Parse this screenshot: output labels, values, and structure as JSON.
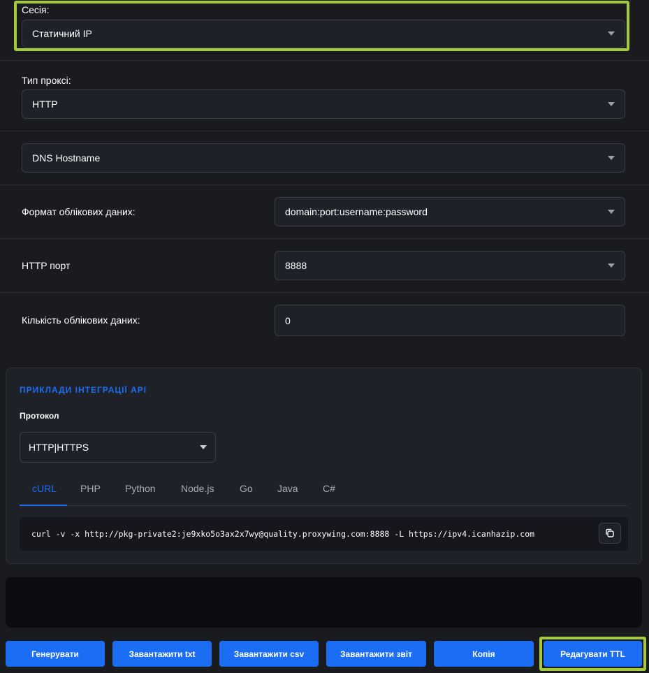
{
  "session": {
    "label": "Сесія:",
    "value": "Статичний IP"
  },
  "proxy_type": {
    "label": "Тип проксі:",
    "value": "HTTP"
  },
  "dns": {
    "value": "DNS Hostname"
  },
  "credentials_format": {
    "label": "Формат облікових даних:",
    "value": "domain:port:username:password"
  },
  "http_port": {
    "label": "HTTP порт",
    "value": "8888"
  },
  "credentials_count": {
    "label": "Кількість облікових даних:",
    "value": "0"
  },
  "api": {
    "title": "ПРИКЛАДИ ІНТЕГРАЦІЇ API",
    "protocol_label": "Протокол",
    "protocol_value": "HTTP|HTTPS",
    "tabs": [
      "cURL",
      "PHP",
      "Python",
      "Node.js",
      "Go",
      "Java",
      "C#"
    ],
    "active_tab": "cURL",
    "code": "curl -v -x http://pkg-private2:je9xko5o3ax2x7wy@quality.proxywing.com:8888 -L https://ipv4.icanhazip.com"
  },
  "buttons": {
    "generate": "Генерувати",
    "download_txt": "Завантажити txt",
    "download_csv": "Завантажити csv",
    "download_report": "Завантажити звіт",
    "copy": "Копія",
    "edit_ttl": "Редагувати TTL"
  },
  "colors": {
    "accent": "#1b6ef3",
    "highlight": "#a4c93a",
    "background": "#1a1b1e"
  }
}
